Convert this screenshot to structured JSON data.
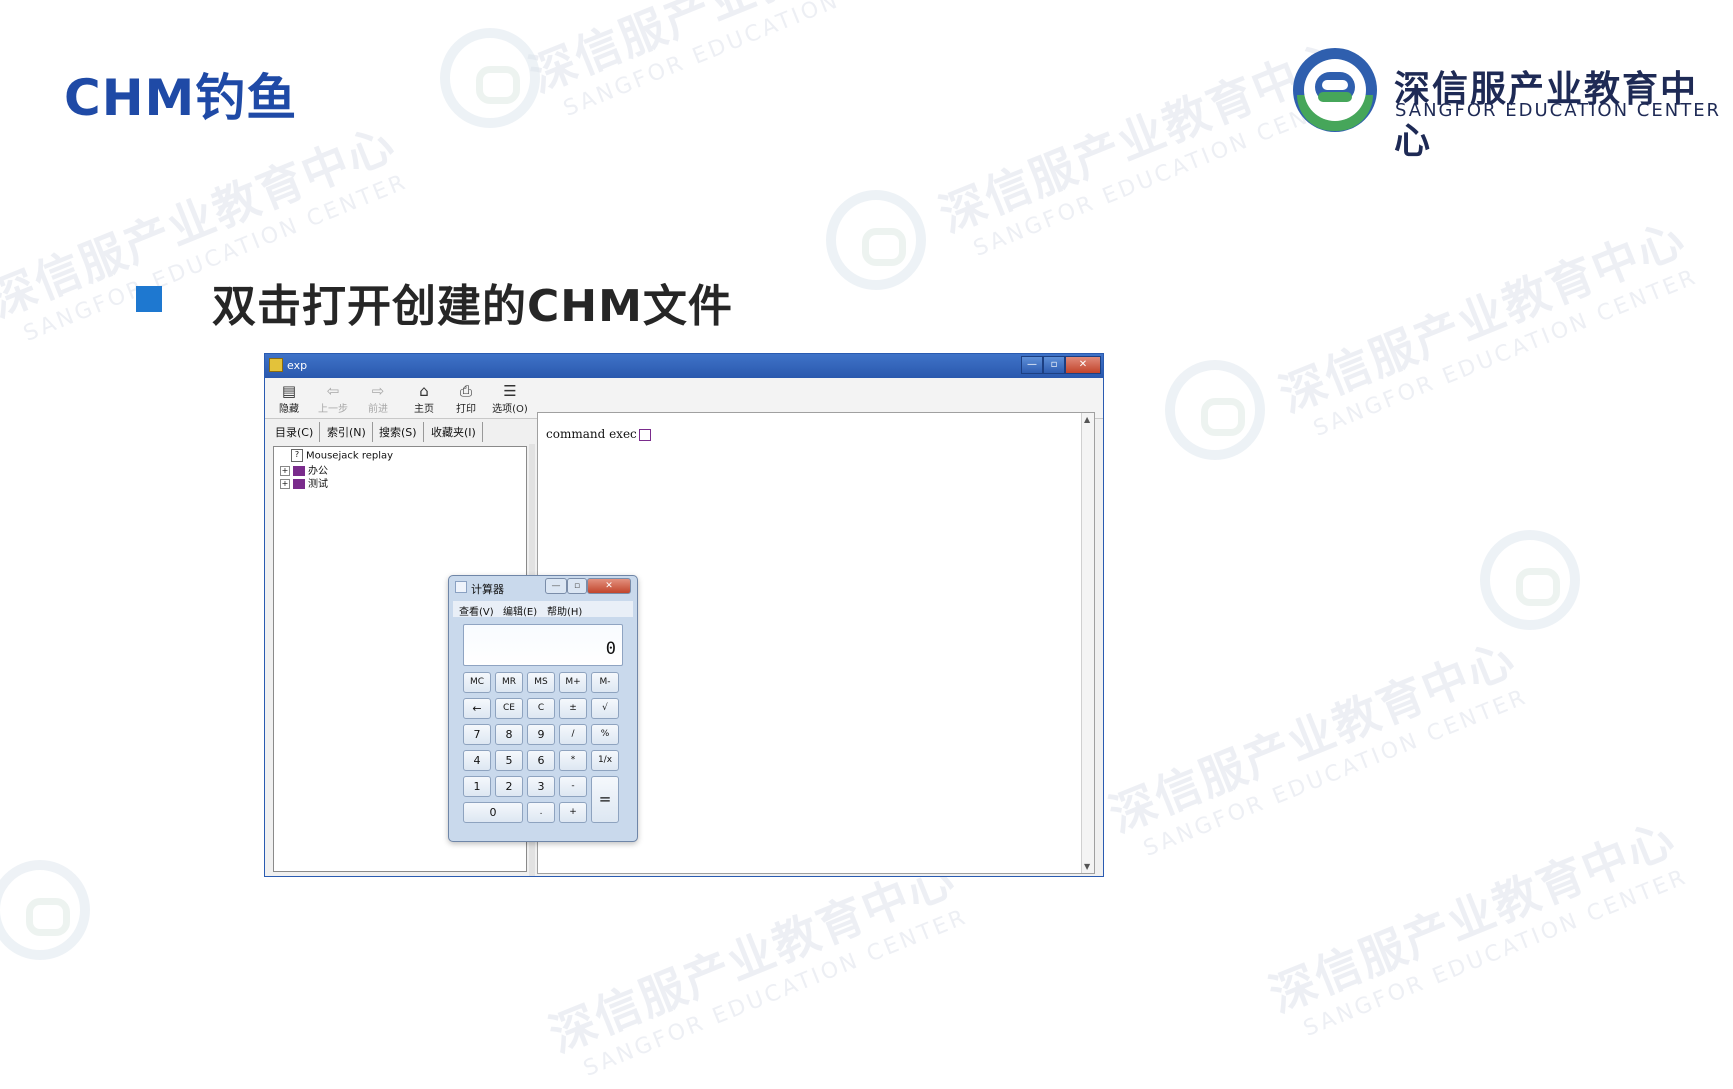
{
  "slide": {
    "title": "CHM钓鱼",
    "bullet": "双击打开创建的CHM文件",
    "logo_cn": "深信服产业教育中心",
    "logo_en": "SANGFOR EDUCATION CENTER",
    "watermark_cn": "深信服产业教育中心",
    "watermark_en": "SANGFOR EDUCATION CENTER"
  },
  "help_window": {
    "title": "exp",
    "titlebar_buttons": [
      "—",
      "▫",
      "✕"
    ],
    "toolbar": [
      {
        "label": "隐藏",
        "icon": "hide-icon",
        "glyph": "▤",
        "disabled": false
      },
      {
        "label": "上一步",
        "icon": "back-arrow-icon",
        "glyph": "⇦",
        "disabled": true
      },
      {
        "label": "前进",
        "icon": "forward-arrow-icon",
        "glyph": "⇨",
        "disabled": true
      },
      {
        "label": "主页",
        "icon": "home-icon",
        "glyph": "⌂",
        "disabled": false
      },
      {
        "label": "打印",
        "icon": "print-icon",
        "glyph": "⎙",
        "disabled": false
      },
      {
        "label": "选项(O)",
        "icon": "options-icon",
        "glyph": "☰",
        "disabled": false
      }
    ],
    "tabs": [
      "目录(C)",
      "索引(N)",
      "搜索(S)",
      "收藏夹(I)"
    ],
    "tree": [
      {
        "label": "Mousejack replay",
        "type": "page"
      },
      {
        "label": "办公",
        "type": "book"
      },
      {
        "label": "测试",
        "type": "book"
      }
    ],
    "content_text": "command exec"
  },
  "calculator": {
    "title": "计算器",
    "menu": [
      "查看(V)",
      "编辑(E)",
      "帮助(H)"
    ],
    "display": "0",
    "rows": [
      [
        "MC",
        "MR",
        "MS",
        "M+",
        "M-"
      ],
      [
        "←",
        "CE",
        "C",
        "±",
        "√"
      ],
      [
        "7",
        "8",
        "9",
        "/",
        "%"
      ],
      [
        "4",
        "5",
        "6",
        "*",
        "1/x"
      ],
      [
        "1",
        "2",
        "3",
        "-"
      ],
      [
        "0",
        ".",
        "+"
      ]
    ],
    "equals": "="
  }
}
